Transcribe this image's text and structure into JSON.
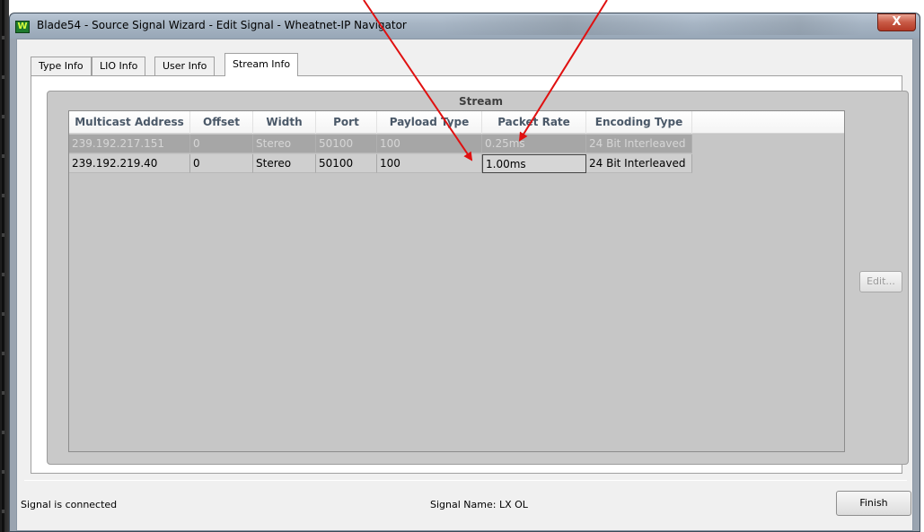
{
  "window": {
    "title": "Blade54 - Source Signal Wizard - Edit Signal - Wheatnet-IP Navigator",
    "app_icon_glyph": "W",
    "close_glyph": "X",
    "close_color": "#c85a45"
  },
  "tabs": [
    {
      "label": "Type Info",
      "active": false
    },
    {
      "label": "LIO Info",
      "active": false
    },
    {
      "label": "User Info",
      "active": false
    },
    {
      "label": "Stream Info",
      "active": true
    }
  ],
  "stream": {
    "group_title": "Stream",
    "columns": [
      "Multicast Address",
      "Offset",
      "Width",
      "Port",
      "Payload Type",
      "Packet Rate",
      "Encoding Type"
    ],
    "rows": [
      {
        "multicast_address": "239.192.217.151",
        "offset": "0",
        "width": "Stereo",
        "port": "50100",
        "payload_type": "100",
        "packet_rate": "0.25ms",
        "encoding_type": "24 Bit Interleaved",
        "selected": true
      },
      {
        "multicast_address": "239.192.219.40",
        "offset": "0",
        "width": "Stereo",
        "port": "50100",
        "payload_type": "100",
        "packet_rate": "1.00ms",
        "encoding_type": "24 Bit Interleaved",
        "selected": false
      }
    ],
    "edit_label": "Edit..."
  },
  "footer": {
    "status": "Signal is connected",
    "signal_name_label": "Signal Name:",
    "signal_name": "LX OL",
    "finish_label": "Finish"
  },
  "annotation_color": "#e01010"
}
